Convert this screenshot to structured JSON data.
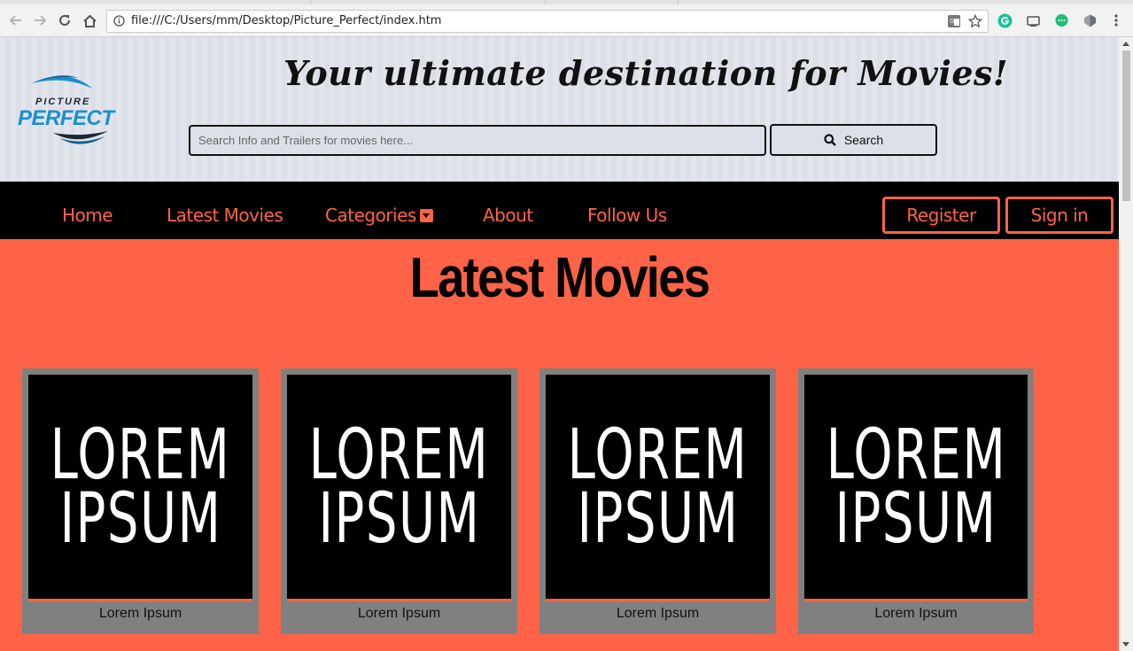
{
  "browser": {
    "url": "file:///C:/Users/mm/Desktop/Picture_Perfect/index.htm"
  },
  "header": {
    "logo_line1": "PICTURE",
    "logo_line2": "PERFECT",
    "tagline": "Your ultimate destination for Movies!",
    "search_placeholder": "Search Info and Trailers for movies here...",
    "search_button": "Search"
  },
  "nav": {
    "items": [
      "Home",
      "Latest Movies",
      "Categories",
      "About",
      "Follow Us"
    ],
    "register": "Register",
    "signin": "Sign in"
  },
  "main": {
    "title": "Latest Movies",
    "cards": [
      {
        "poster_line1": "LOREM",
        "poster_line2": "IPSUM",
        "caption": "Lorem Ipsum"
      },
      {
        "poster_line1": "LOREM",
        "poster_line2": "IPSUM",
        "caption": "Lorem Ipsum"
      },
      {
        "poster_line1": "LOREM",
        "poster_line2": "IPSUM",
        "caption": "Lorem Ipsum"
      },
      {
        "poster_line1": "LOREM",
        "poster_line2": "IPSUM",
        "caption": "Lorem Ipsum"
      }
    ]
  },
  "colors": {
    "accent": "#ff6347",
    "nav_bg": "#000000",
    "card_frame": "#808080",
    "logo_blue": "#1a8fd0"
  }
}
